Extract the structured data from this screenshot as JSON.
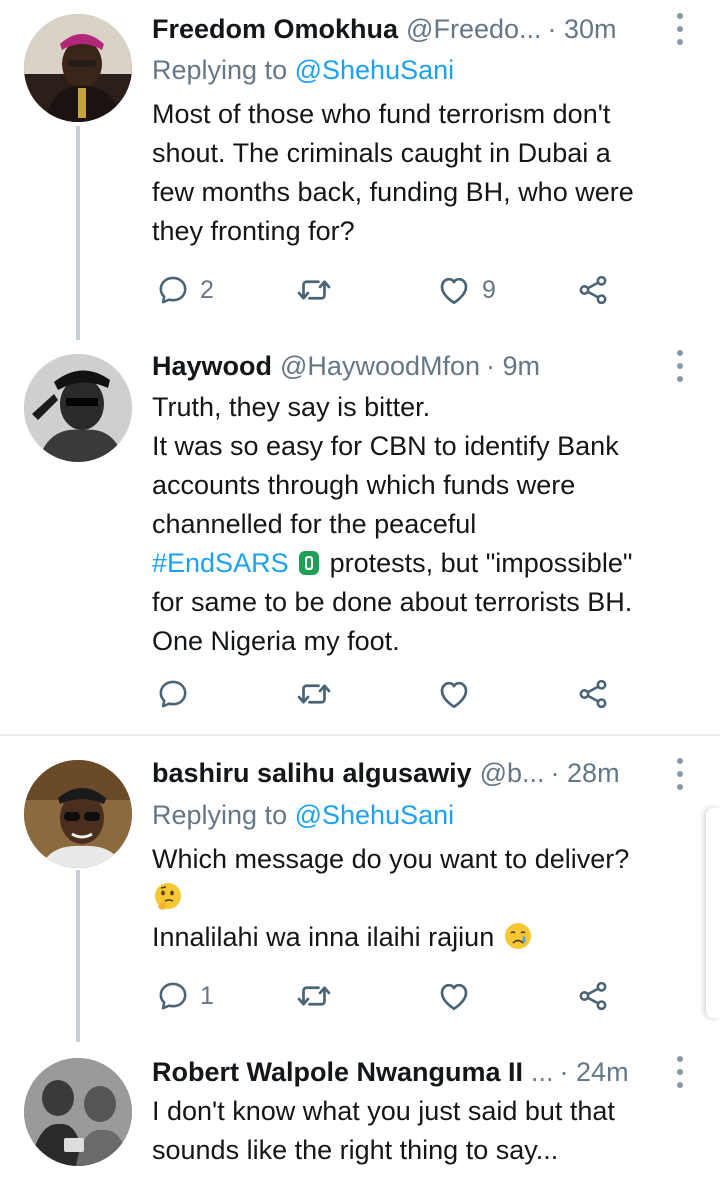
{
  "tweets": [
    {
      "name": "Freedom Omokhua",
      "handle": "@Freedo...",
      "time": "· 30m",
      "replying_prefix": "Replying to",
      "replying_to": "@ShehuSani",
      "lines": [
        "Most of those who fund terrorism don't",
        "shout. The criminals caught in Dubai a",
        "few months back, funding BH, who were",
        "they fronting for?"
      ],
      "reply_count": "2",
      "retweet_count": "",
      "like_count": "9"
    },
    {
      "name": "Haywood",
      "handle": "@HaywoodMfon",
      "time": "· 9m",
      "lines": [
        "Truth, they say is bitter.",
        "It was so easy for CBN to identify Bank",
        "accounts through which funds were",
        "channelled for the peaceful"
      ],
      "hashtag": "#EndSARS",
      "hashtag_rest": "protests, but \"impossible\"",
      "lines_after": [
        "for same to be done about terrorists BH.",
        "One Nigeria my foot."
      ],
      "reply_count": "",
      "retweet_count": "",
      "like_count": ""
    },
    {
      "name": "bashiru salihu algusawiy",
      "handle": "@b...",
      "time": "· 28m",
      "replying_prefix": "Replying to",
      "replying_to": "@ShehuSani",
      "line1": "Which message do you want to deliver?",
      "line3": "Innalilahi wa inna ilaihi rajiun",
      "reply_count": "1",
      "retweet_count": "",
      "like_count": ""
    },
    {
      "name": "Robert Walpole Nwanguma II",
      "handle": "...",
      "time": "· 24m",
      "lines": [
        "I don't know what you just said but that",
        "sounds like the right thing to say..."
      ]
    }
  ],
  "icons": {
    "reply": "reply-icon",
    "retweet": "retweet-icon",
    "like": "heart-icon",
    "share": "share-icon",
    "more": "more-vertical-icon"
  },
  "colors": {
    "link": "#1da1f2",
    "muted": "#657786",
    "text": "#14171a",
    "thread_line": "#c4cfd6"
  }
}
